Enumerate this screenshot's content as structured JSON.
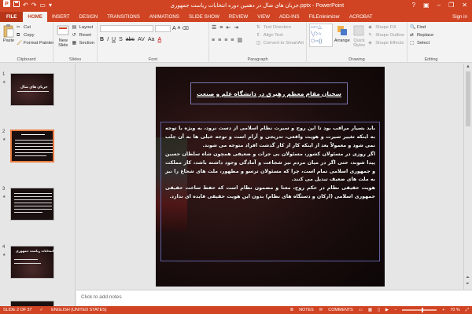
{
  "window": {
    "title": "جریان های ضال در دهمین دوره انتخابات ریاست جمهوری.pptx - PowerPoint",
    "help": "?",
    "minimize": "–",
    "restore": "❐",
    "close": "✕"
  },
  "tabs": [
    "FILE",
    "HOME",
    "INSERT",
    "DESIGN",
    "TRANSITIONS",
    "ANIMATIONS",
    "SLIDE SHOW",
    "REVIEW",
    "VIEW",
    "ADD-INS",
    "FILEminimizer",
    "ACROBAT"
  ],
  "active_tab": "HOME",
  "sign_in": "Sign in",
  "ribbon": {
    "clipboard": {
      "label": "Clipboard",
      "paste": "Paste",
      "cut": "Cut",
      "copy": "Copy",
      "format_painter": "Format Painter"
    },
    "slides": {
      "label": "Slides",
      "new_slide": "New Slide",
      "layout": "Layout",
      "reset": "Reset",
      "section": "Section"
    },
    "font": {
      "label": "Font"
    },
    "paragraph": {
      "label": "Paragraph",
      "text_direction": "Text Direction",
      "align_text": "Align Text",
      "convert": "Convert to SmartArt"
    },
    "drawing": {
      "label": "Drawing",
      "arrange": "Arrange",
      "quick_styles": "Quick Styles",
      "shape_fill": "Shape Fill",
      "shape_outline": "Shape Outline",
      "shape_effects": "Shape Effects"
    },
    "editing": {
      "label": "Editing",
      "find": "Find",
      "replace": "Replace",
      "select": "Select"
    }
  },
  "thumbnails": [
    {
      "num": "1",
      "star": "★",
      "title": "جریان های ضال"
    },
    {
      "num": "2",
      "star": "★"
    },
    {
      "num": "3",
      "star": "★"
    },
    {
      "num": "4",
      "star": "★",
      "title": "انتخابات ریاست جمهوری"
    }
  ],
  "slide": {
    "title": "سخنان مقام معظم رهبری در دانشگاه علم و صنعت",
    "body": [
      "باید بسیار مراقب بود تا این روح و سیرت نظام اسلامی از دست نرود، به ویژه با توجه به اینکه تغییر سیرت و هویت واقعی، تدریجی و آرام است و توجه خیلی ها به آن جلب نمی شود و معمولاً بعد از اینکه کار از کار گذشت افراد متوجه می شوند.",
      "اگر روزی در مسئولان کشور، مسئولان بی جرات و ضعیفی همچون شاه سلطان حسین پیدا شوند، حتی اگر در میان مردم نیز شجاعت و آمادگی وجود داشته باشد، کار مملکت و جمهوری اسلامی تمام است، چرا که مسئولان ترسو و مطهور، ملت های شجاع را نیز به ملت های ضعیف تبدیل می کنند.",
      "هویت حقیقی نظام در حکم روح، معنا و مضمون نظام است که حفظ ساخت حقیقی جمهوری اسلامی (ارکان و دستگاه های نظام) بدون این هویت حقیقی فایده ای ندارد."
    ]
  },
  "notes_placeholder": "Click to add notes",
  "status": {
    "slide_info": "SLIDE 2 OF 37",
    "language": "ENGLISH (UNITED STATES)",
    "notes": "NOTES",
    "comments": "COMMENTS",
    "zoom": "70 %",
    "zoom_minus": "−",
    "zoom_plus": "+"
  },
  "colors": {
    "accent": "#d04423",
    "ribbon_bg": "#f3f3f3",
    "selected_thumb": "#e8793e"
  }
}
